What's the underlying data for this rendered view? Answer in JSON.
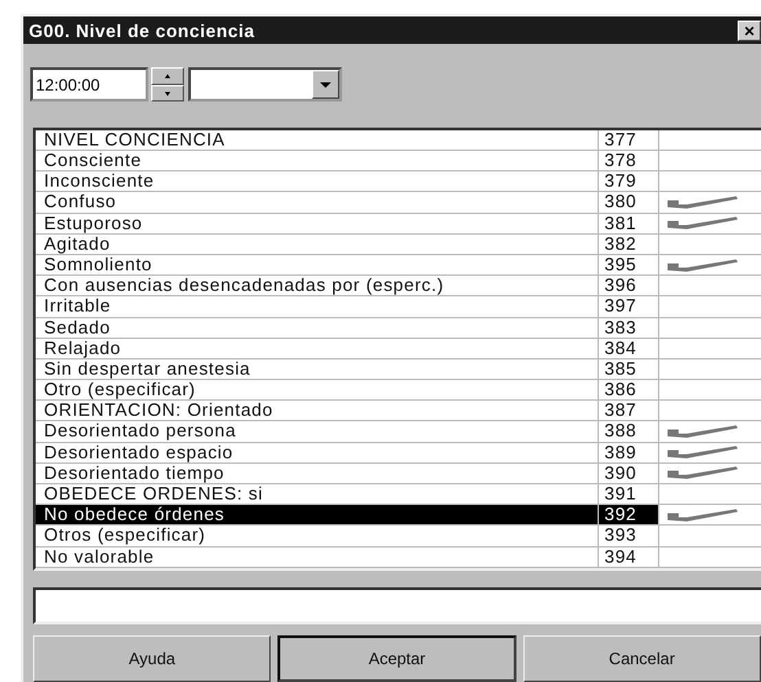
{
  "window": {
    "title": "G00. Nivel de conciencia",
    "close": "×"
  },
  "time_field": {
    "value": "12:00:00"
  },
  "items": [
    {
      "label": "NIVEL CONCIENCIA",
      "code": "377",
      "checked": false,
      "selected": false
    },
    {
      "label": "Consciente",
      "code": "378",
      "checked": false,
      "selected": false
    },
    {
      "label": "Inconsciente",
      "code": "379",
      "checked": false,
      "selected": false
    },
    {
      "label": "Confuso",
      "code": "380",
      "checked": true,
      "selected": false
    },
    {
      "label": "Estuporoso",
      "code": "381",
      "checked": true,
      "selected": false
    },
    {
      "label": "Agitado",
      "code": "382",
      "checked": false,
      "selected": false
    },
    {
      "label": "Somnoliento",
      "code": "395",
      "checked": true,
      "selected": false
    },
    {
      "label": "Con ausencias desencadenadas por (esperc.)",
      "code": "396",
      "checked": false,
      "selected": false
    },
    {
      "label": "Irritable",
      "code": "397",
      "checked": false,
      "selected": false
    },
    {
      "label": "Sedado",
      "code": "383",
      "checked": false,
      "selected": false
    },
    {
      "label": "Relajado",
      "code": "384",
      "checked": false,
      "selected": false
    },
    {
      "label": "Sin despertar anestesia",
      "code": "385",
      "checked": false,
      "selected": false
    },
    {
      "label": "Otro (especificar)",
      "code": "386",
      "checked": false,
      "selected": false
    },
    {
      "label": "ORIENTACION: Orientado",
      "code": "387",
      "checked": false,
      "selected": false
    },
    {
      "label": "Desorientado persona",
      "code": "388",
      "checked": true,
      "selected": false
    },
    {
      "label": "Desorientado espacio",
      "code": "389",
      "checked": true,
      "selected": false
    },
    {
      "label": "Desorientado tiempo",
      "code": "390",
      "checked": true,
      "selected": false
    },
    {
      "label": "OBEDECE ORDENES: si",
      "code": "391",
      "checked": false,
      "selected": false
    },
    {
      "label": "No obedece órdenes",
      "code": "392",
      "checked": true,
      "selected": true
    },
    {
      "label": "Otros (especificar)",
      "code": "393",
      "checked": false,
      "selected": false
    },
    {
      "label": "No valorable",
      "code": "394",
      "checked": false,
      "selected": false
    }
  ],
  "buttons": [
    {
      "label": "Ayuda",
      "default": false
    },
    {
      "label": "Aceptar",
      "default": true
    },
    {
      "label": "Cancelar",
      "default": false
    }
  ]
}
